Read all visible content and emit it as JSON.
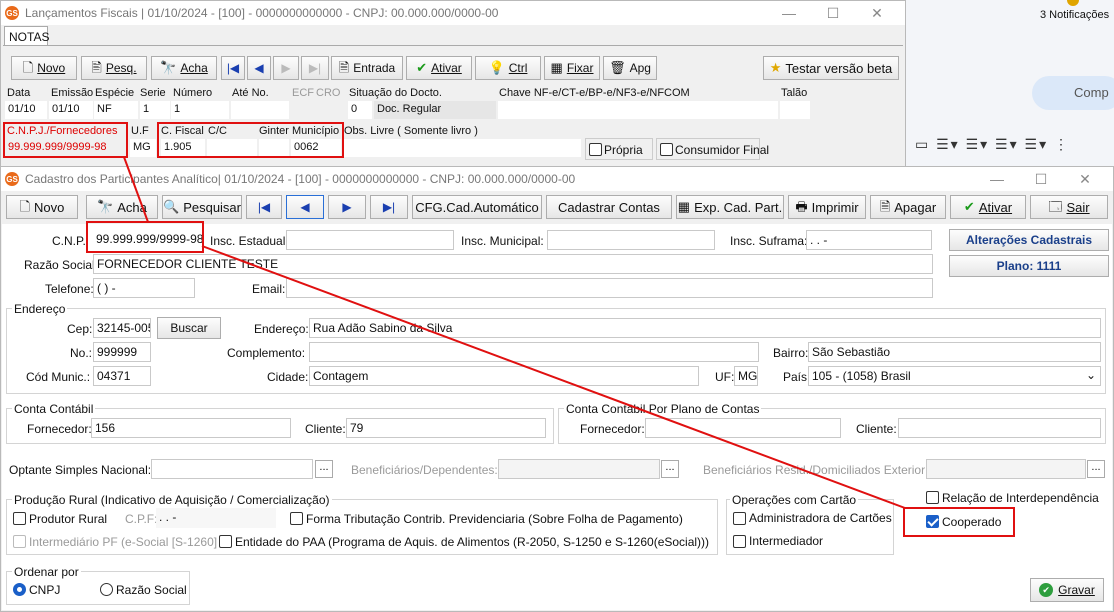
{
  "background": {
    "notifications": "3 Notificações",
    "comp_text": "Comp"
  },
  "win1": {
    "title": "Lançamentos Fiscais | 01/10/2024 - [100] - 0000000000000 - CNPJ: 00.000.000/0000-00",
    "tab": "NOTAS",
    "toolbar": {
      "novo": "Novo",
      "pesq": "Pesq.",
      "acha": "Acha",
      "entrada": "Entrada",
      "ativar": "Ativar",
      "ctrl": "Ctrl",
      "fixar": "Fixar",
      "apg": "Apg",
      "testar": "Testar versão beta"
    },
    "headers": {
      "data": "Data",
      "emissao": "Emissão",
      "especie": "Espécie",
      "serie": "Serie",
      "numero": "Número",
      "ate_no": "Até No.",
      "ecf": "ECF",
      "cro": "CRO",
      "situacao": "Situação do Docto.",
      "chave": "Chave NF-e/CT-e/BP-e/NF3-e/NFCOM",
      "talao": "Talão"
    },
    "values": {
      "data": "01/10",
      "emissao": "01/10",
      "especie": "NF",
      "serie": "1",
      "numero": "1",
      "situacao_code": "0",
      "situacao": "Doc. Regular"
    },
    "row2": {
      "cnpj_label": "C.N.P.J./Fornecedores",
      "cnpj": "99.999.999/9999-98",
      "uf_label": "U.F",
      "uf": "MG",
      "cfiscal_label": "C. Fiscal",
      "cc_label": "C/C",
      "ginter_label": "Ginter",
      "municipio_label": "Município",
      "cfiscal": "1.905",
      "municipio": "0062",
      "obs_label": "Obs. Livre ( Somente livro )",
      "propria": "Própria",
      "consumidor": "Consumidor Final"
    }
  },
  "win2": {
    "title": "Cadastro dos Participantes Analítico| 01/10/2024 - [100] - 0000000000000 - CNPJ: 00.000.000/0000-00",
    "toolbar": {
      "novo": "Novo",
      "acha": "Acha",
      "pesquisar": "Pesquisar",
      "cfg": "CFG.Cad.Automático",
      "cadastrar": "Cadastrar Contas",
      "exp": "Exp. Cad. Part.",
      "imprimir": "Imprimir",
      "apagar": "Apagar",
      "ativar": "Ativar",
      "sair": "Sair"
    },
    "labels": {
      "cnpj": "C.N.P.",
      "insc_estadual": "Insc. Estadual:",
      "insc_municipal": "Insc. Municipal:",
      "insc_suframa": "Insc. Suframa:",
      "razao": "Razão Social:",
      "telefone": "Telefone:",
      "email": "Email:",
      "endereco_group": "Endereço",
      "cep": "Cep:",
      "buscar": "Buscar",
      "endereco": "Endereço:",
      "no": "No.:",
      "complemento": "Complemento:",
      "bairro": "Bairro:",
      "cod_munic": "Cód Munic.:",
      "cidade": "Cidade:",
      "uf": "UF:",
      "pais": "País:",
      "conta_contabil": "Conta Contábil",
      "fornecedor": "Fornecedor:",
      "cliente": "Cliente:",
      "conta_plano": "Conta Contábil Por Plano de Contas",
      "fornecedor2": "Fornecedor:",
      "cliente2": "Cliente:",
      "optante": "Optante Simples Nacional:",
      "beneficiarios": "Beneficiários/Dependentes:",
      "benef_resid": "Beneficiários Resid./Domiciliados Exterior:",
      "producao_rural": "Produção Rural (Indicativo de Aquisição / Comercialização)",
      "produtor_rural": "Produtor Rural",
      "cpf": "C.P.F:",
      "forma_trib": "Forma Tributação Contrib. Previdenciaria (Sobre Folha de Pagamento)",
      "intermediario": "Intermediário PF (e-Social [S-1260]",
      "paa": "Entidade do PAA (Programa de Aquis. de Alimentos (R-2050, S-1250 e S-1260(eSocial)))",
      "op_cartao": "Operações com Cartão",
      "admin_cartoes": "Administradora de Cartões",
      "intermediador": "Intermediador",
      "relacao": "Relação de Interdependência",
      "cooperado": "Cooperado",
      "ordenar": "Ordenar por",
      "ord_cnpj": "CNPJ",
      "ord_razao": "Razão Social",
      "gravar": "Gravar",
      "alteracoes": "Alterações Cadastrais",
      "plano": "Plano: 1111"
    },
    "values": {
      "cnpj": "99.999.999/9999-98",
      "suframa": " .  .  -",
      "razao": "FORNECEDOR CLIENTE TESTE",
      "telefone": "(  )    -",
      "cep": "32145-005",
      "endereco": "Rua Adão Sabino da Silva",
      "no": "999999",
      "bairro": "São Sebastião",
      "cod_munic": "04371",
      "cidade": "Contagem",
      "uf": "MG",
      "pais": "105 - (1058) Brasil",
      "fornecedor": "156",
      "cliente": "79",
      "cpf": " .  .  -",
      "dots": "..."
    },
    "state": {
      "cooperado": true,
      "ordenar": "CNPJ"
    }
  },
  "colors": {
    "highlight": "#e01010",
    "accent": "#1a5fc8"
  }
}
